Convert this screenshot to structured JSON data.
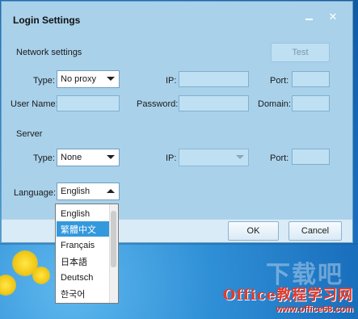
{
  "window": {
    "title": "Login Settings"
  },
  "network": {
    "section_label": "Network settings",
    "test_button": "Test",
    "type_label": "Type:",
    "type_value": "No proxy",
    "ip_label": "IP:",
    "port_label": "Port:",
    "username_label": "User Name:",
    "password_label": "Password:",
    "domain_label": "Domain:"
  },
  "server": {
    "section_label": "Server",
    "type_label": "Type:",
    "type_value": "None",
    "ip_label": "IP:",
    "port_label": "Port:"
  },
  "language": {
    "label": "Language:",
    "value": "English",
    "options": [
      "English",
      "繁體中文",
      "Français",
      "日本語",
      "Deutsch",
      "한국어"
    ],
    "highlighted": "繁體中文"
  },
  "footer": {
    "ok_button": "OK",
    "cancel_button": "Cancel"
  },
  "watermark": {
    "logo": "Office教程学习网",
    "url": "www.office68.com"
  }
}
